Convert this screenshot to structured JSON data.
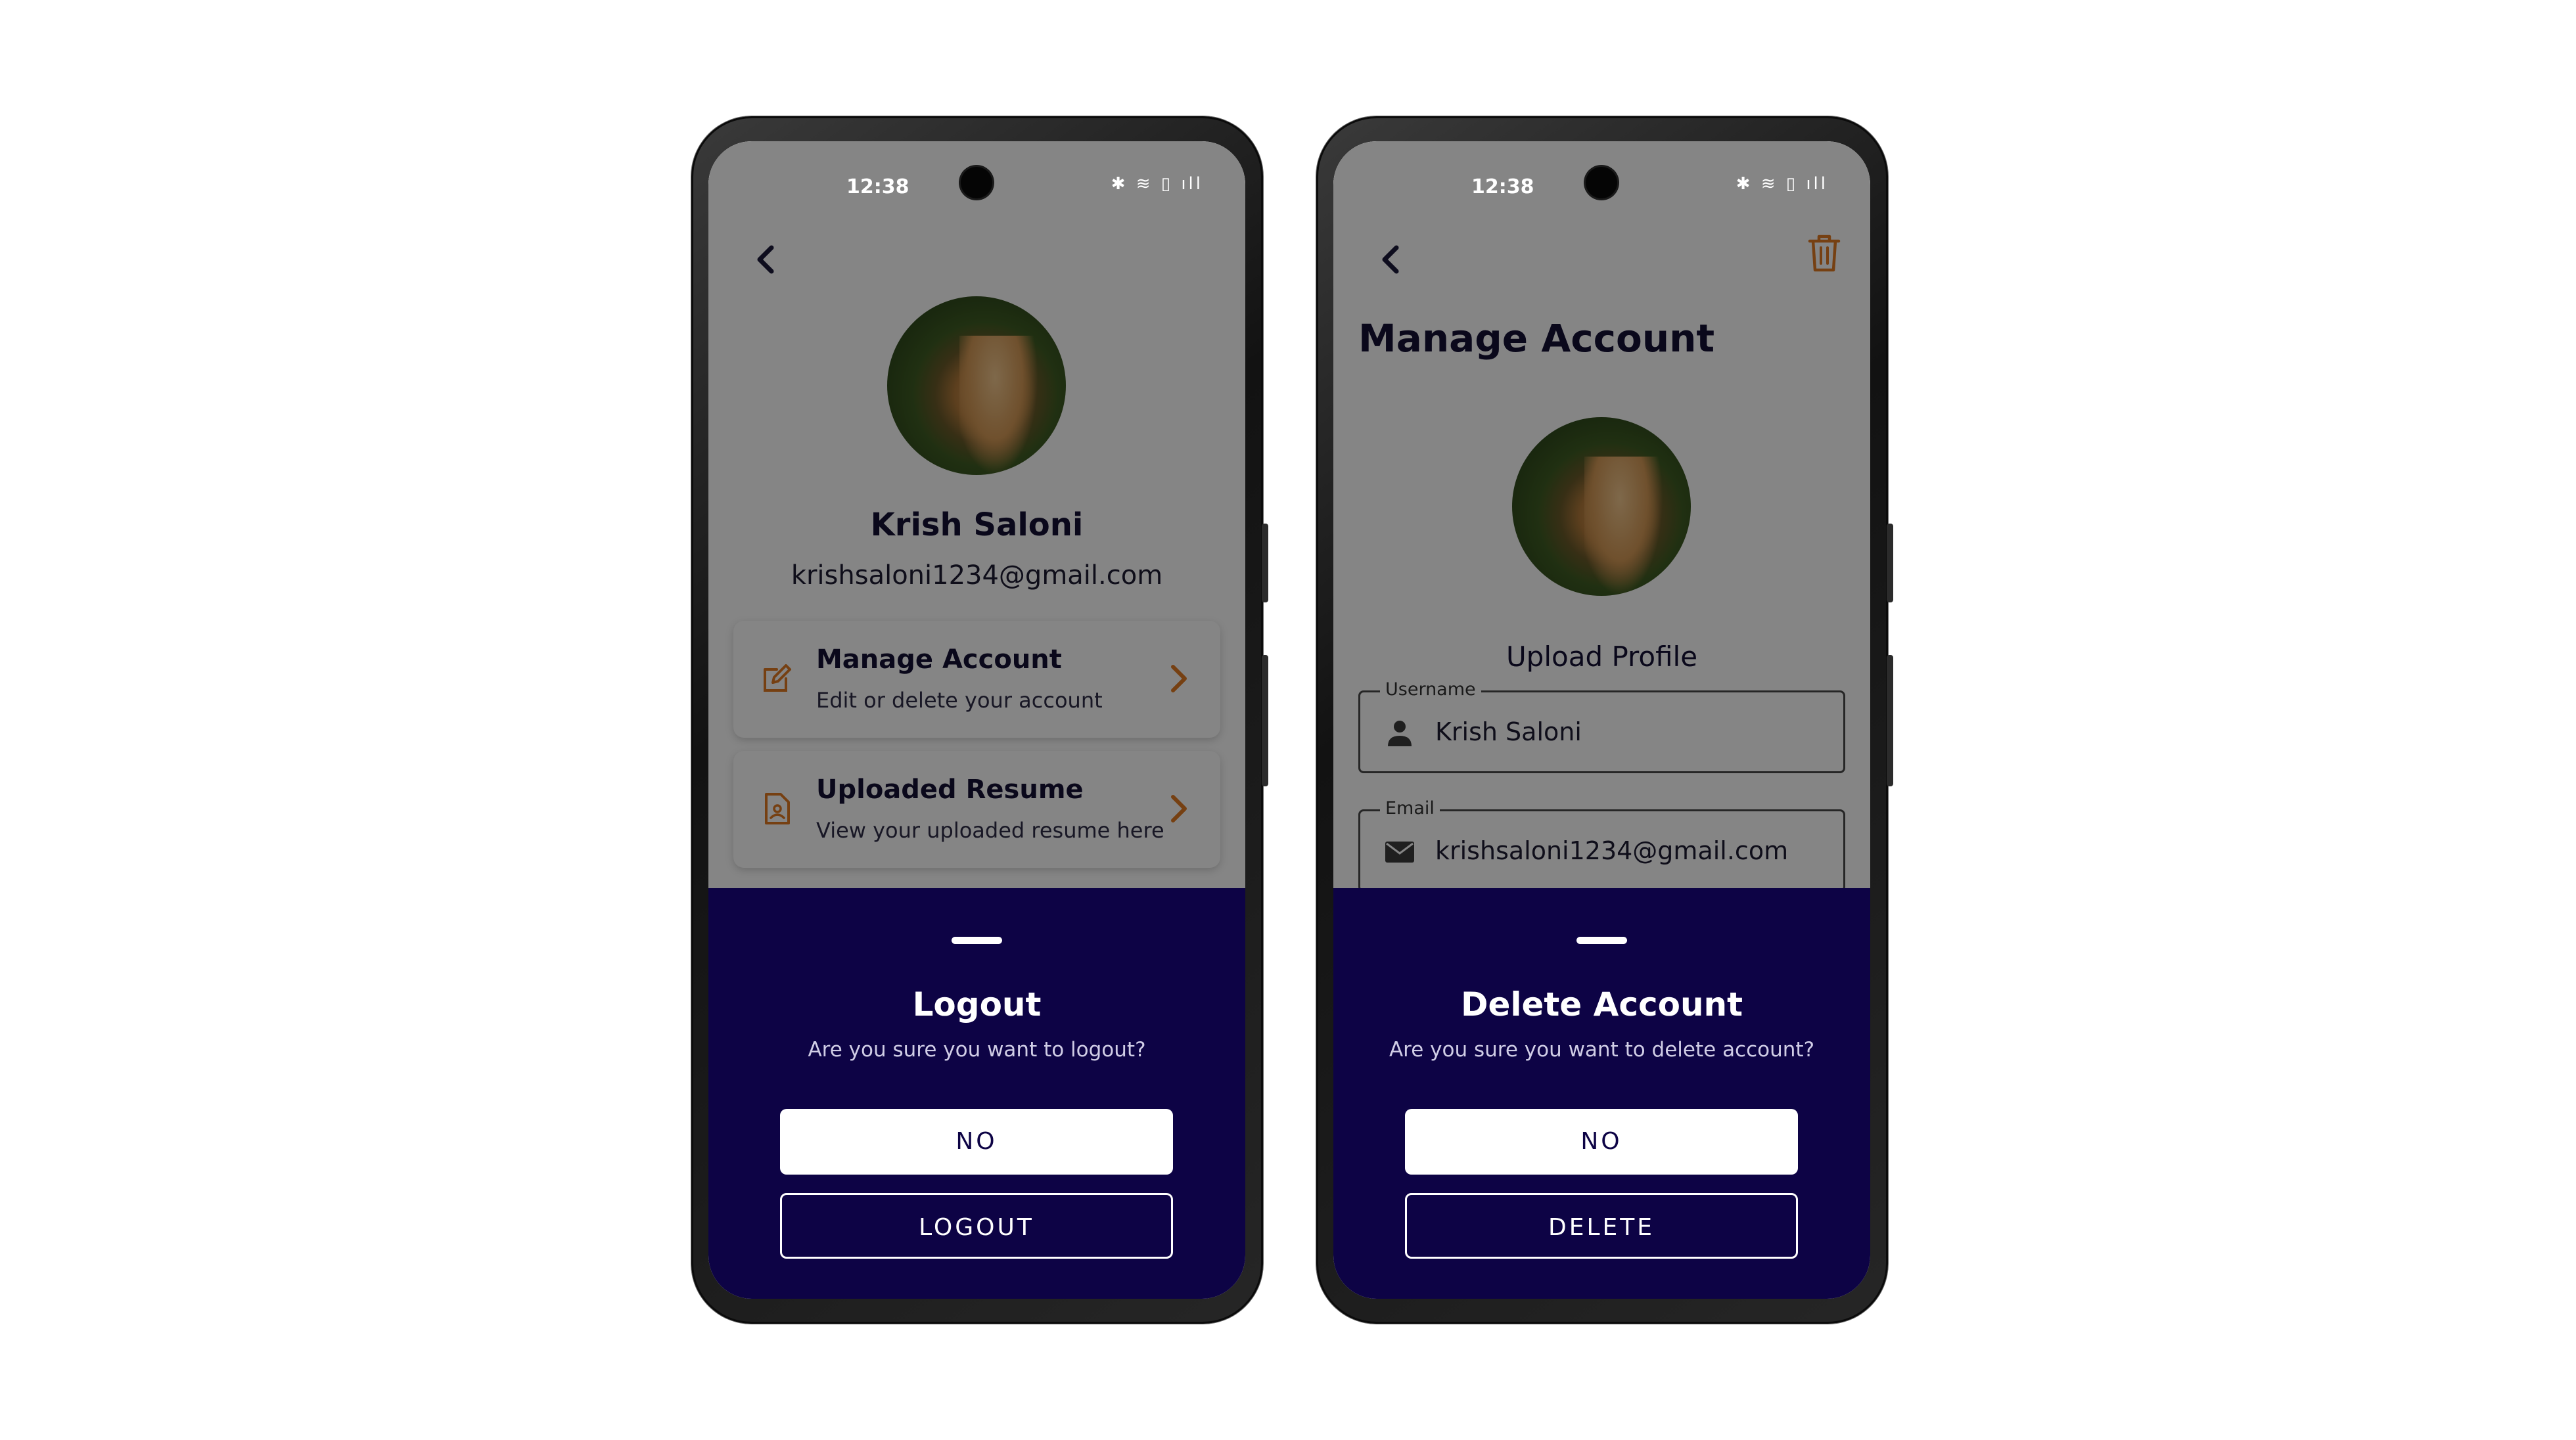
{
  "status_bar": {
    "time": "12:38",
    "icons": "✱ ≋ ▯ ıll"
  },
  "logout_screen": {
    "profile_name": "Krish Saloni",
    "profile_email": "krishsaloni1234@gmail.com",
    "menu": [
      {
        "title": "Manage Account",
        "subtitle": "Edit or delete your account"
      },
      {
        "title": "Uploaded Resume",
        "subtitle": "View your uploaded resume here"
      }
    ],
    "sheet": {
      "title": "Logout",
      "message": "Are you sure you want to logout?",
      "no_label": "NO",
      "confirm_label": "LOGOUT"
    }
  },
  "delete_screen": {
    "page_title": "Manage Account",
    "upload_label": "Upload Profile",
    "username_label": "Username",
    "username_value": "Krish Saloni",
    "email_label": "Email",
    "email_value": "krishsaloni1234@gmail.com",
    "sheet": {
      "title": "Delete Account",
      "message": "Are you sure you want to delete account?",
      "no_label": "NO",
      "confirm_label": "DELETE"
    }
  },
  "colors": {
    "sheet_bg": "#0d0345",
    "accent_orange": "#e37b24",
    "text_dark": "#141134"
  }
}
